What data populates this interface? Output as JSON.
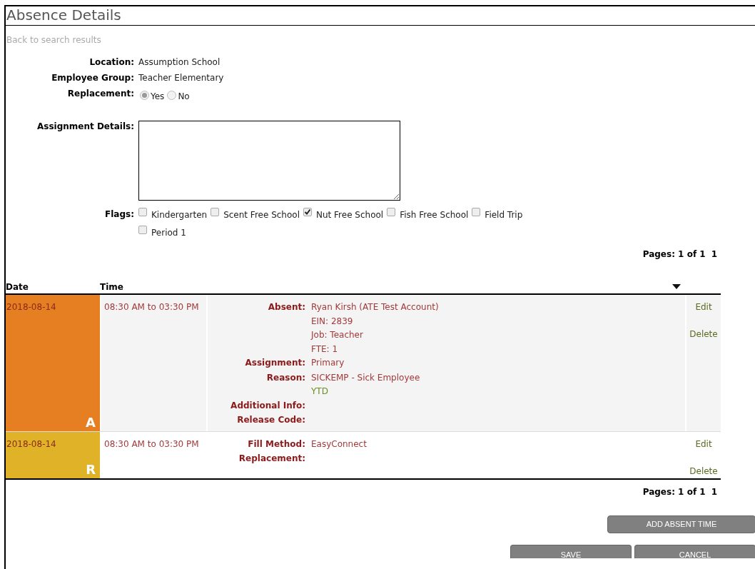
{
  "title": "Absence Details",
  "back_link": "Back to search results",
  "fields": [
    {
      "label": "Location:",
      "value": "Assumption School"
    },
    {
      "label": "Employee Group:",
      "value": "Teacher Elementary"
    }
  ],
  "replacement": {
    "label": "Replacement:",
    "options": [
      {
        "label": "Yes",
        "selected": true
      },
      {
        "label": "No",
        "selected": false
      }
    ]
  },
  "assignment_details": {
    "label": "Assignment Details:"
  },
  "flags": {
    "label": "Flags:",
    "items": [
      {
        "label": "Kindergarten",
        "checked": false
      },
      {
        "label": "Scent Free School",
        "checked": false
      },
      {
        "label": "Nut Free School",
        "checked": true
      },
      {
        "label": "Fish Free School",
        "checked": false
      },
      {
        "label": "Field Trip",
        "checked": false
      },
      {
        "label": "Period 1",
        "checked": false
      }
    ]
  },
  "pager_top": {
    "label": "Pages: 1 of 1",
    "page": "1"
  },
  "table": {
    "columns": [
      "Date",
      "Time"
    ],
    "rows": [
      {
        "date": "2018-08-14",
        "time": "08:30 AM to 03:30 PM",
        "color": "#e67e22",
        "badge": "A",
        "details": [
          {
            "label": "Absent:",
            "values": [
              {
                "text": "Ryan Kirsh (ATE Test Account)",
                "kind": "normal"
              },
              {
                "text": "EIN: 2839",
                "kind": "normal"
              },
              {
                "text": "Job: Teacher",
                "kind": "normal"
              },
              {
                "text": "FTE: 1",
                "kind": "normal"
              }
            ]
          },
          {
            "label": "Assignment:",
            "values": [
              {
                "text": "Primary",
                "kind": "normal"
              }
            ]
          },
          {
            "label": "Reason:",
            "values": [
              {
                "text": "SICKEMP - Sick Employee",
                "kind": "normal"
              },
              {
                "text": "YTD",
                "kind": "note"
              }
            ]
          },
          {
            "label": "Additional Info:"
          },
          {
            "label": "Release Code:"
          }
        ],
        "actions": [
          "Edit",
          "Delete"
        ]
      },
      {
        "date": "2018-08-14",
        "time": "08:30 AM to 03:30 PM",
        "color": "#dfb227",
        "badge": "R",
        "details": [
          {
            "label": "Fill Method:",
            "values": [
              {
                "text": "EasyConnect",
                "kind": "normal"
              }
            ]
          },
          {
            "label": "Replacement:"
          }
        ],
        "actions": [
          "Edit",
          "Delete"
        ]
      }
    ]
  },
  "pager_bottom": {
    "label": "Pages: 1 of 1",
    "page": "1"
  },
  "buttons": {
    "add": "ADD ABSENT TIME",
    "save": "SAVE",
    "cancel": "CANCEL"
  }
}
